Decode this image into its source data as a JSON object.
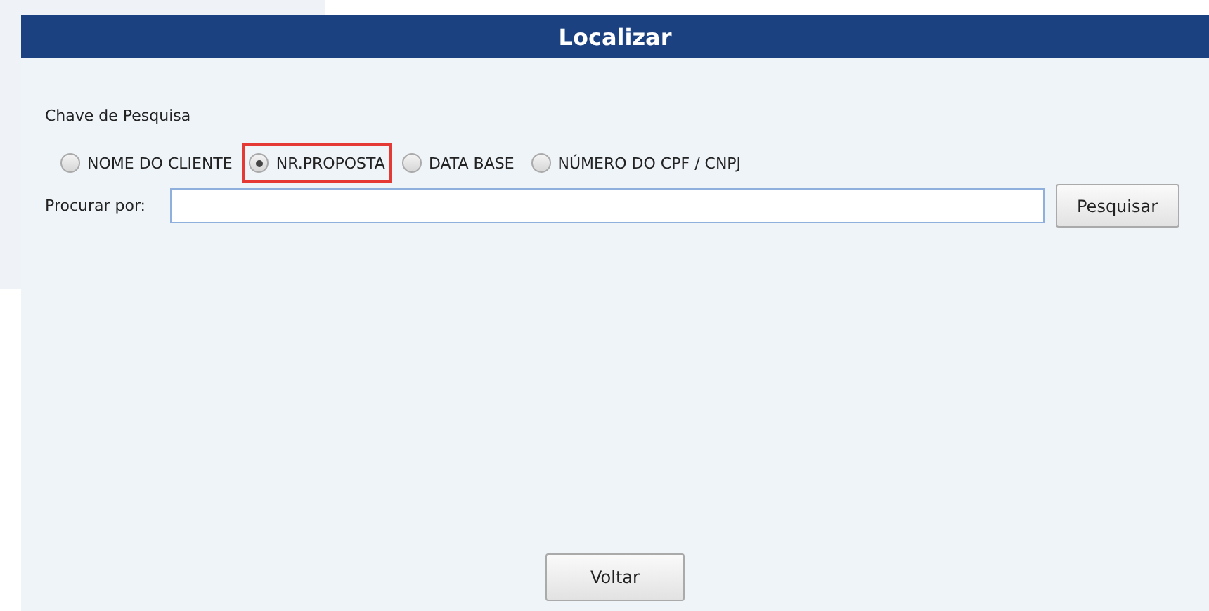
{
  "title": "Localizar",
  "search_key": {
    "label": "Chave de Pesquisa",
    "options": [
      {
        "label": "NOME DO CLIENTE",
        "selected": false,
        "highlighted": false
      },
      {
        "label": "NR.PROPOSTA",
        "selected": true,
        "highlighted": true
      },
      {
        "label": "DATA BASE",
        "selected": false,
        "highlighted": false
      },
      {
        "label": "NÚMERO DO CPF / CNPJ",
        "selected": false,
        "highlighted": false
      }
    ]
  },
  "search_field": {
    "label": "Procurar por:"
  },
  "search_button": "Pesquisar",
  "back_button": "Voltar"
}
